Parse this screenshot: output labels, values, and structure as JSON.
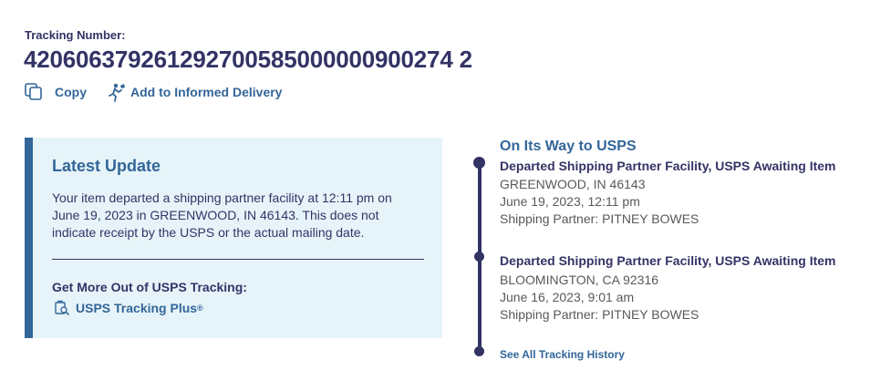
{
  "tracking": {
    "label": "Tracking Number:",
    "number": "420606379261292700585000000900274 2"
  },
  "actions": {
    "copy_label": "Copy",
    "informed_label": "Add to Informed Delivery"
  },
  "latest_update": {
    "title": "Latest Update",
    "text": "Your item departed a shipping partner facility at 12:11 pm on June 19, 2023 in GREENWOOD, IN 46143. This does not indicate receipt by the USPS or the actual mailing date.",
    "more_title": "Get More Out of USPS Tracking:",
    "plus_label": "USPS Tracking Plus",
    "plus_sup": "®"
  },
  "timeline": {
    "status": "On Its Way to USPS",
    "events": [
      {
        "title": "Departed Shipping Partner Facility, USPS Awaiting Item",
        "location": "GREENWOOD, IN 46143",
        "datetime": "June 19, 2023, 12:11 pm",
        "partner": "Shipping Partner: PITNEY BOWES"
      },
      {
        "title": "Departed Shipping Partner Facility, USPS Awaiting Item",
        "location": "BLOOMINGTON, CA 92316",
        "datetime": "June 16, 2023, 9:01 am",
        "partner": "Shipping Partner: PITNEY BOWES"
      }
    ],
    "see_all_label": "See All Tracking History"
  },
  "icons": {
    "copy": "copy-icon",
    "informed": "person-running-icon",
    "plus": "tracking-plus-icon"
  },
  "colors": {
    "navy": "#333366",
    "link_blue": "#336699",
    "box_bg": "#e6f4f9",
    "muted": "#595959"
  }
}
